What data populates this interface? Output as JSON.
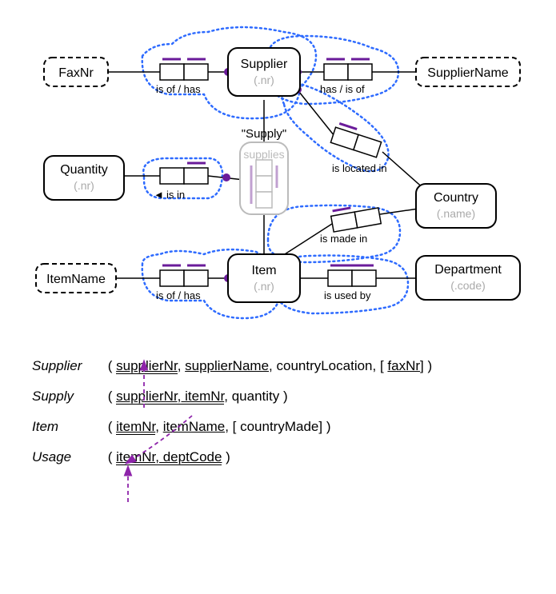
{
  "orm": {
    "entities": {
      "supplier": {
        "name": "Supplier",
        "ref": "(.nr)"
      },
      "faxnr": {
        "name": "FaxNr"
      },
      "suppliername": {
        "name": "SupplierName"
      },
      "country": {
        "name": "Country",
        "ref": "(.name)"
      },
      "quantity": {
        "name": "Quantity",
        "ref": "(.nr)"
      },
      "item": {
        "name": "Item",
        "ref": "(.nr)"
      },
      "itemname": {
        "name": "ItemName"
      },
      "department": {
        "name": "Department",
        "ref": "(.code)"
      }
    },
    "supply": {
      "title": "\"Supply\"",
      "verb": "supplies"
    },
    "roles": {
      "fax_supplier": "is of / has",
      "supplier_name": "has / is of",
      "supplier_country": "is located in",
      "quantity_supply": "is in",
      "quantity_arrow": "◄",
      "item_country": "is made in",
      "item_name": "is of / has",
      "item_dept": "is used by"
    }
  },
  "schema": {
    "supplier": {
      "rel": "Supplier",
      "open": "(",
      "a1": "supplierNr",
      "c1": ", ",
      "a2": "supplierName",
      "c2": ", ",
      "a3": "countryLocation",
      "c3": ", [",
      "a4": "faxNr",
      "close": "] )"
    },
    "supply": {
      "rel": "Supply",
      "open": "(",
      "a1": "supplierNr, itemNr",
      "c1": ", ",
      "a2": "quantity",
      "close": " )"
    },
    "item": {
      "rel": "Item",
      "open": "(",
      "a1": "itemNr",
      "c1": ", ",
      "a2": "itemName",
      "c2": ", [",
      "a3": "countryMade",
      "close": "] )"
    },
    "usage": {
      "rel": "Usage",
      "open": "(",
      "a1": "itemNr, deptCode",
      "close": " )"
    }
  }
}
